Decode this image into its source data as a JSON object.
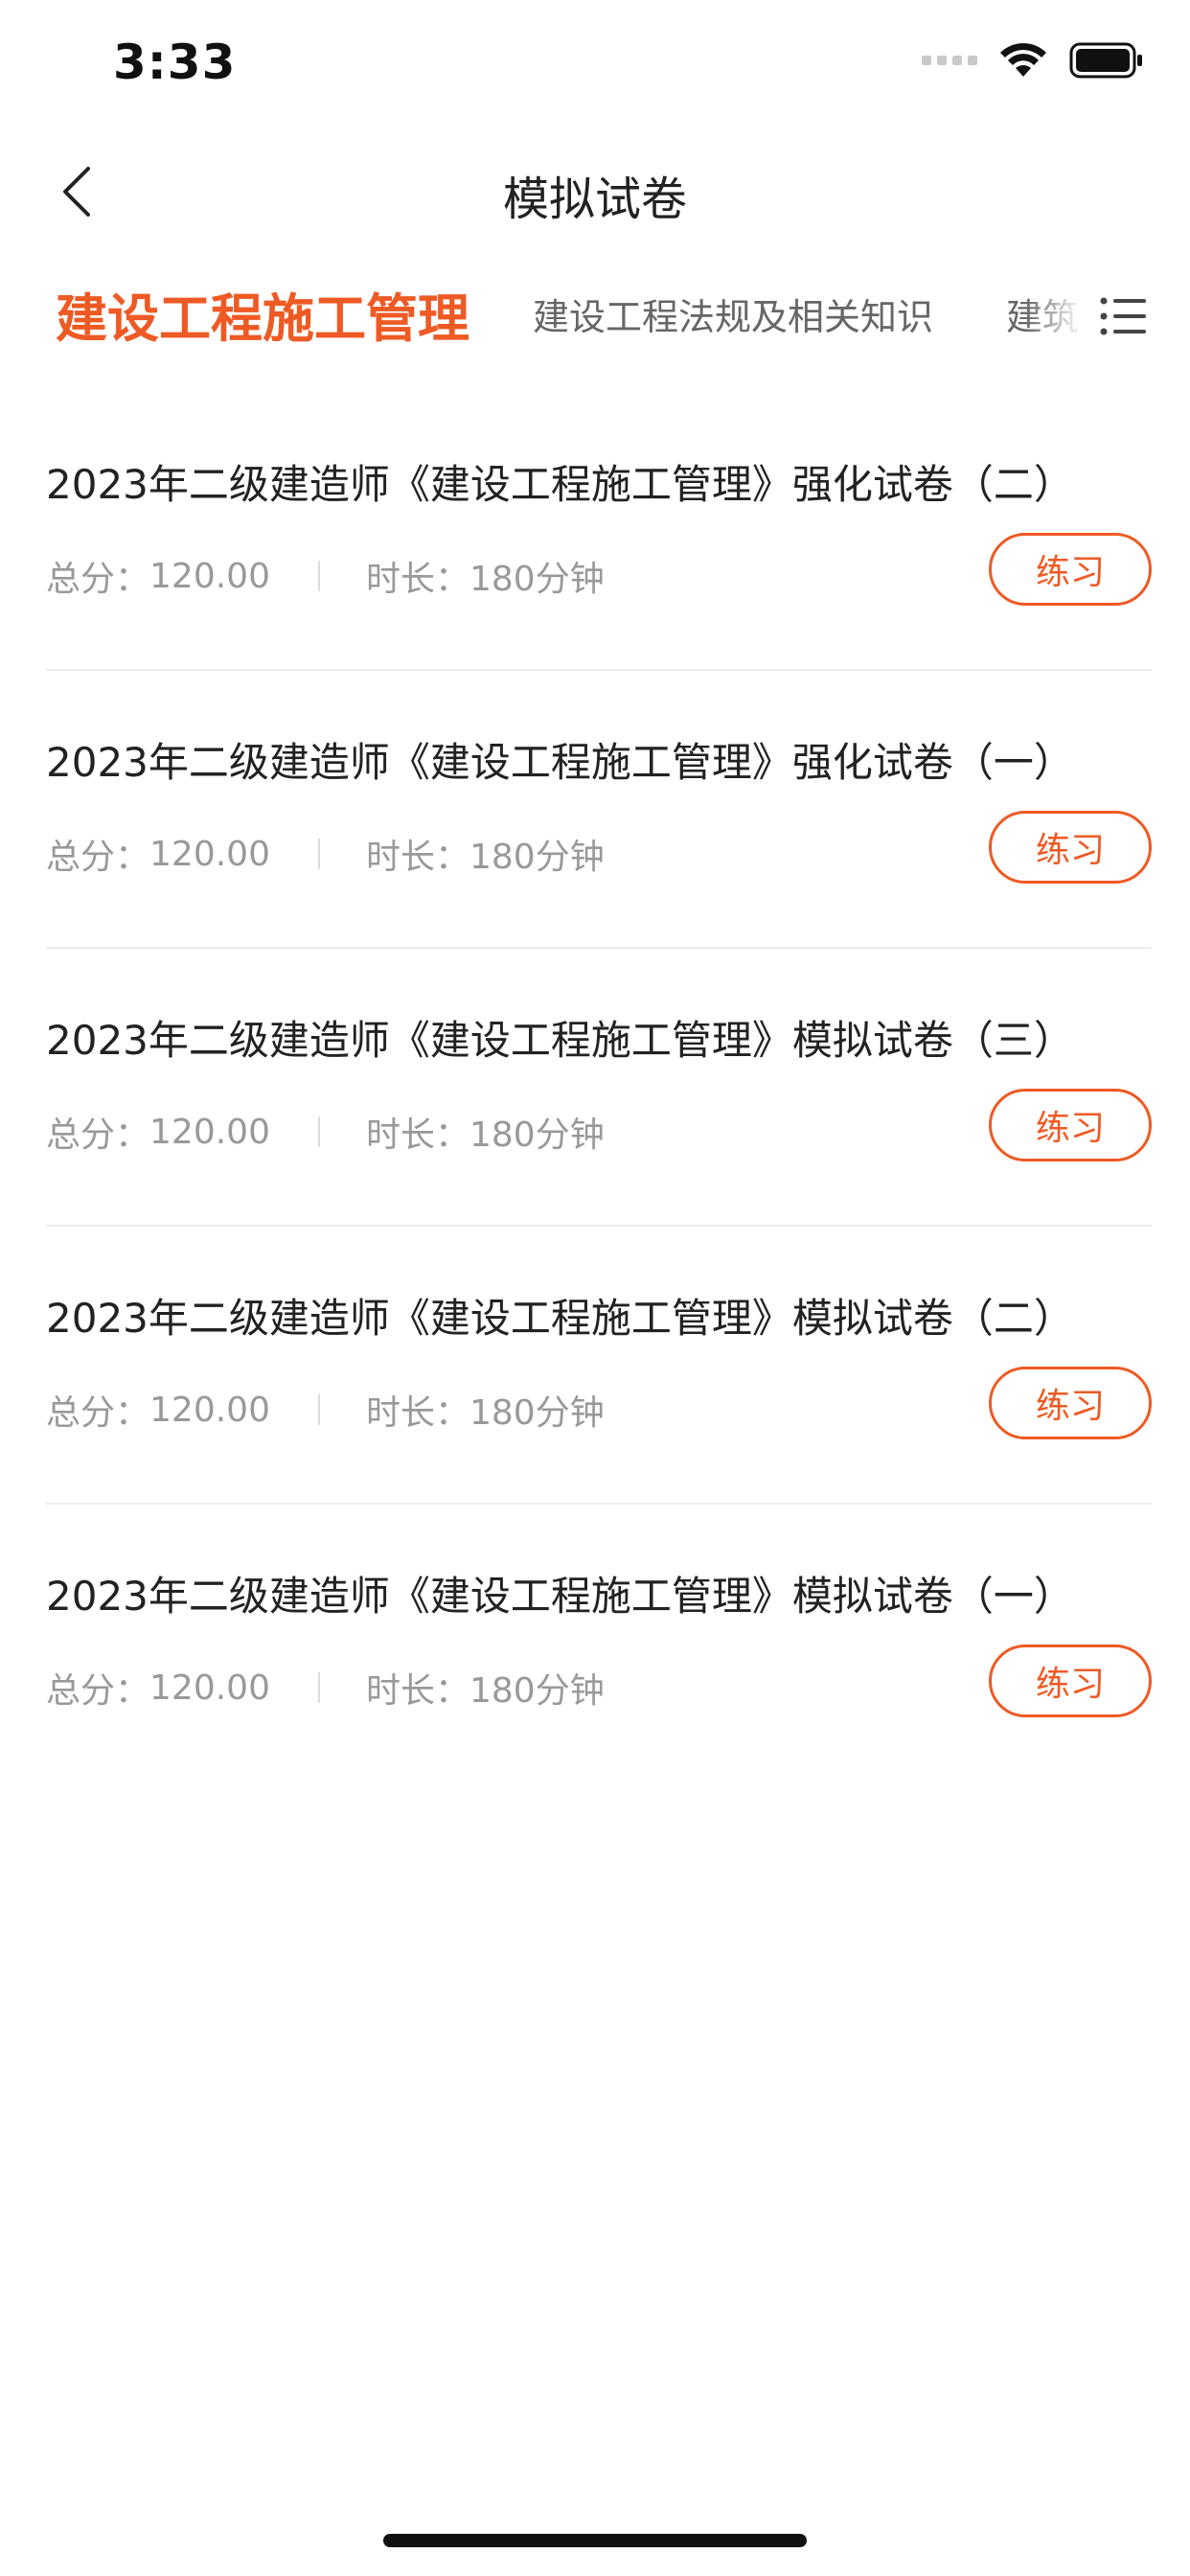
{
  "status_bar": {
    "time": "3:33"
  },
  "nav": {
    "title": "模拟试卷"
  },
  "tabs": [
    {
      "label": "建设工程施工管理",
      "active": true
    },
    {
      "label": "建设工程法规及相关知识",
      "active": false
    },
    {
      "label": "建筑",
      "active": false
    }
  ],
  "exams": [
    {
      "title": "2023年二级建造师《建设工程施工管理》强化试卷（二）",
      "score_label": "总分：",
      "score": "120.00",
      "duration_label": "时长：",
      "duration": "180分钟",
      "action": "练习"
    },
    {
      "title": "2023年二级建造师《建设工程施工管理》强化试卷（一）",
      "score_label": "总分：",
      "score": "120.00",
      "duration_label": "时长：",
      "duration": "180分钟",
      "action": "练习"
    },
    {
      "title": "2023年二级建造师《建设工程施工管理》模拟试卷（三）",
      "score_label": "总分：",
      "score": "120.00",
      "duration_label": "时长：",
      "duration": "180分钟",
      "action": "练习"
    },
    {
      "title": "2023年二级建造师《建设工程施工管理》模拟试卷（二）",
      "score_label": "总分：",
      "score": "120.00",
      "duration_label": "时长：",
      "duration": "180分钟",
      "action": "练习"
    },
    {
      "title": "2023年二级建造师《建设工程施工管理》模拟试卷（一）",
      "score_label": "总分：",
      "score": "120.00",
      "duration_label": "时长：",
      "duration": "180分钟",
      "action": "练习"
    }
  ],
  "icons": {
    "back": "chevron-left-icon",
    "wifi": "wifi-icon",
    "battery": "battery-icon",
    "signal": "cellular-signal-icon",
    "category_list": "list-icon"
  },
  "colors": {
    "accent": "#ee5a24",
    "title_text": "#222222",
    "meta_text": "#999999",
    "divider": "#ececec"
  }
}
